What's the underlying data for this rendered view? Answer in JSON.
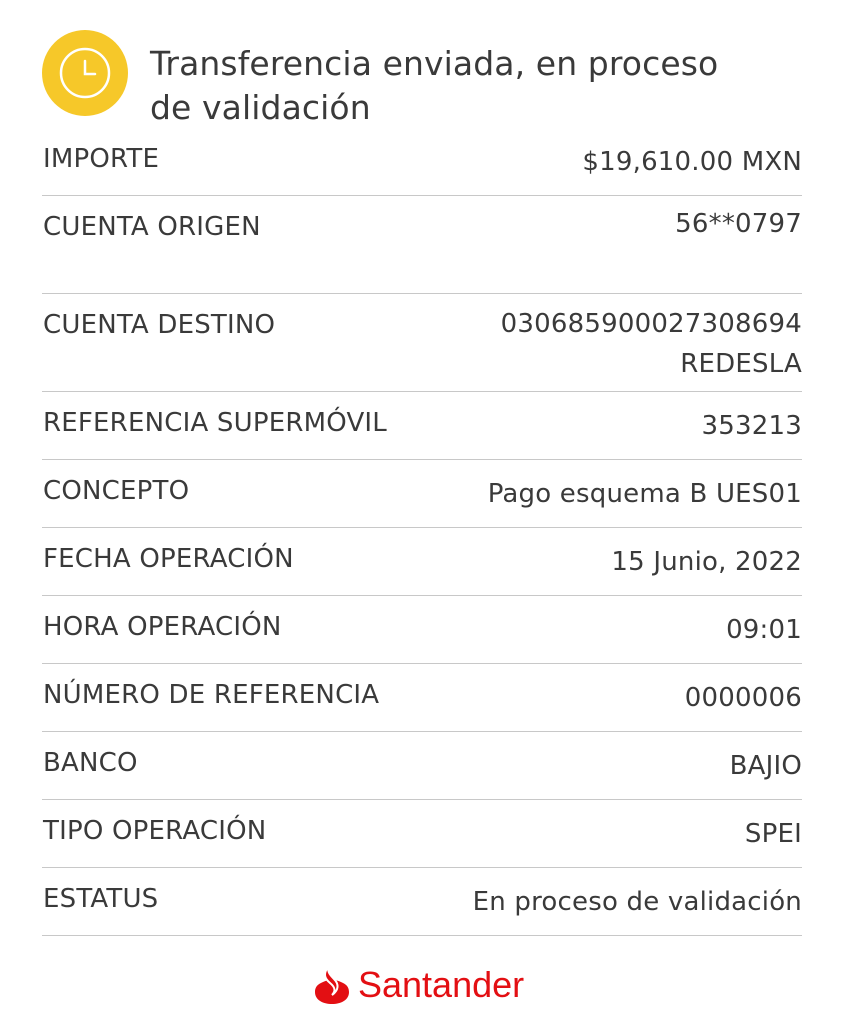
{
  "header": {
    "title": "Transferencia enviada, en proceso de validación",
    "icon": "clock-icon",
    "icon_color": "#f6c829"
  },
  "details": [
    {
      "label": "IMPORTE",
      "value": "$19,610.00 MXN"
    },
    {
      "label": "CUENTA ORIGEN",
      "value": "56**0797"
    },
    {
      "label": "CUENTA DESTINO",
      "value": "030685900027308694",
      "value2": "REDESLA"
    },
    {
      "label": "REFERENCIA SUPERMÓVIL",
      "value": "353213"
    },
    {
      "label": "CONCEPTO",
      "value": "Pago esquema B UES01"
    },
    {
      "label": "FECHA OPERACIÓN",
      "value": "15 Junio, 2022"
    },
    {
      "label": "HORA OPERACIÓN",
      "value": "09:01"
    },
    {
      "label": "NÚMERO DE REFERENCIA",
      "value": "0000006"
    },
    {
      "label": "BANCO",
      "value": "BAJIO"
    },
    {
      "label": "TIPO OPERACIÓN",
      "value": "SPEI"
    },
    {
      "label": "ESTATUS",
      "value": "En proceso de validación"
    }
  ],
  "footer": {
    "brand": "Santander",
    "brand_color": "#e30f13",
    "logo_icon": "santander-flame-icon"
  }
}
